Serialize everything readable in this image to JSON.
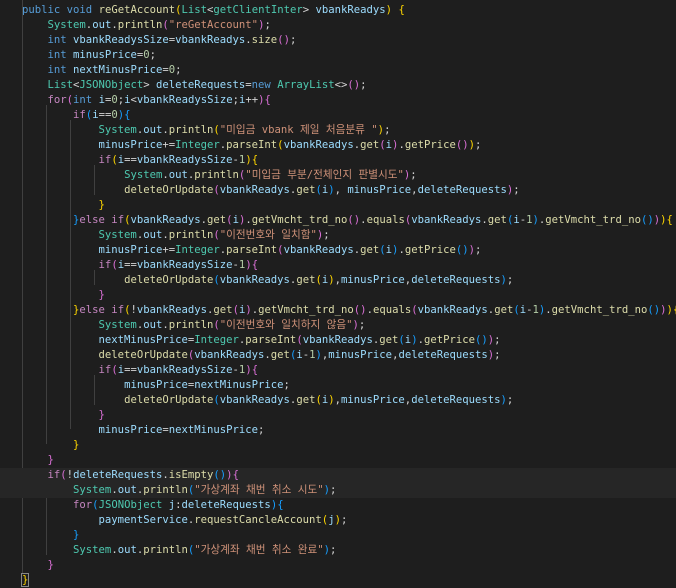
{
  "theme": {
    "background": "#1e1e1e",
    "line_highlight": "#262626",
    "keyword": "#569cd6",
    "control": "#c586c0",
    "type": "#4ec9b0",
    "function": "#dcdcaa",
    "variable": "#9cdcfe",
    "string": "#ce9178",
    "number": "#b5cea8",
    "text": "#d4d4d4",
    "bracket1": "#ffd700",
    "bracket2": "#da70d6",
    "bracket3": "#179fff"
  },
  "code_lines": [
    [
      [
        "k",
        "public"
      ],
      [
        "p",
        " "
      ],
      [
        "k",
        "void"
      ],
      [
        "p",
        " "
      ],
      [
        "f",
        "reGetAccount"
      ],
      [
        "b1",
        "("
      ],
      [
        "t",
        "List"
      ],
      [
        "p",
        "<"
      ],
      [
        "t",
        "getClientInter"
      ],
      [
        "p",
        "> "
      ],
      [
        "v",
        "vbankReadys"
      ],
      [
        "b1",
        ")"
      ],
      [
        "p",
        " "
      ],
      [
        "b1",
        "{"
      ]
    ],
    [
      [
        "p",
        "    "
      ],
      [
        "t",
        "System"
      ],
      [
        "p",
        "."
      ],
      [
        "v",
        "out"
      ],
      [
        "p",
        "."
      ],
      [
        "f",
        "println"
      ],
      [
        "b2",
        "("
      ],
      [
        "s",
        "\"reGetAccount\""
      ],
      [
        "b2",
        ")"
      ],
      [
        "p",
        ";"
      ]
    ],
    [
      [
        "p",
        "    "
      ],
      [
        "k",
        "int"
      ],
      [
        "p",
        " "
      ],
      [
        "v",
        "vbankReadysSize"
      ],
      [
        "p",
        "="
      ],
      [
        "v",
        "vbankReadys"
      ],
      [
        "p",
        "."
      ],
      [
        "f",
        "size"
      ],
      [
        "b2",
        "()"
      ],
      [
        "p",
        ";"
      ]
    ],
    [
      [
        "p",
        "    "
      ],
      [
        "k",
        "int"
      ],
      [
        "p",
        " "
      ],
      [
        "v",
        "minusPrice"
      ],
      [
        "p",
        "="
      ],
      [
        "n",
        "0"
      ],
      [
        "p",
        ";"
      ]
    ],
    [
      [
        "p",
        "    "
      ],
      [
        "k",
        "int"
      ],
      [
        "p",
        " "
      ],
      [
        "v",
        "nextMinusPrice"
      ],
      [
        "p",
        "="
      ],
      [
        "n",
        "0"
      ],
      [
        "p",
        ";"
      ]
    ],
    [
      [
        "p",
        "    "
      ],
      [
        "t",
        "List"
      ],
      [
        "p",
        "<"
      ],
      [
        "t",
        "JSONObject"
      ],
      [
        "p",
        "> "
      ],
      [
        "v",
        "deleteRequests"
      ],
      [
        "p",
        "="
      ],
      [
        "k",
        "new"
      ],
      [
        "p",
        " "
      ],
      [
        "t",
        "ArrayList"
      ],
      [
        "p",
        "<>"
      ],
      [
        "b2",
        "()"
      ],
      [
        "p",
        ";"
      ]
    ],
    [
      [
        "p",
        "    "
      ],
      [
        "c",
        "for"
      ],
      [
        "b2",
        "("
      ],
      [
        "k",
        "int"
      ],
      [
        "p",
        " "
      ],
      [
        "v",
        "i"
      ],
      [
        "p",
        "="
      ],
      [
        "n",
        "0"
      ],
      [
        "p",
        ";"
      ],
      [
        "v",
        "i"
      ],
      [
        "p",
        "<"
      ],
      [
        "v",
        "vbankReadysSize"
      ],
      [
        "p",
        ";"
      ],
      [
        "v",
        "i"
      ],
      [
        "p",
        "++"
      ],
      [
        "b2",
        ")"
      ],
      [
        "b2",
        "{"
      ]
    ],
    [
      [
        "p",
        "        "
      ],
      [
        "c",
        "if"
      ],
      [
        "b3",
        "("
      ],
      [
        "v",
        "i"
      ],
      [
        "p",
        "=="
      ],
      [
        "n",
        "0"
      ],
      [
        "b3",
        ")"
      ],
      [
        "b3",
        "{"
      ]
    ],
    [
      [
        "p",
        "            "
      ],
      [
        "t",
        "System"
      ],
      [
        "p",
        "."
      ],
      [
        "v",
        "out"
      ],
      [
        "p",
        "."
      ],
      [
        "f",
        "println"
      ],
      [
        "b1",
        "("
      ],
      [
        "s",
        "\"미입금 vbank 제일 처음분류 \""
      ],
      [
        "b1",
        ")"
      ],
      [
        "p",
        ";"
      ]
    ],
    [
      [
        "p",
        "            "
      ],
      [
        "v",
        "minusPrice"
      ],
      [
        "p",
        "+="
      ],
      [
        "t",
        "Integer"
      ],
      [
        "p",
        "."
      ],
      [
        "f",
        "parseInt"
      ],
      [
        "b1",
        "("
      ],
      [
        "v",
        "vbankReadys"
      ],
      [
        "p",
        "."
      ],
      [
        "f",
        "get"
      ],
      [
        "b2",
        "("
      ],
      [
        "v",
        "i"
      ],
      [
        "b2",
        ")"
      ],
      [
        "p",
        "."
      ],
      [
        "f",
        "getPrice"
      ],
      [
        "b2",
        "()"
      ],
      [
        "b1",
        ")"
      ],
      [
        "p",
        ";"
      ]
    ],
    [
      [
        "p",
        "            "
      ],
      [
        "c",
        "if"
      ],
      [
        "b1",
        "("
      ],
      [
        "v",
        "i"
      ],
      [
        "p",
        "=="
      ],
      [
        "v",
        "vbankReadysSize"
      ],
      [
        "p",
        "-"
      ],
      [
        "n",
        "1"
      ],
      [
        "b1",
        ")"
      ],
      [
        "b1",
        "{"
      ]
    ],
    [
      [
        "p",
        "                "
      ],
      [
        "t",
        "System"
      ],
      [
        "p",
        "."
      ],
      [
        "v",
        "out"
      ],
      [
        "p",
        "."
      ],
      [
        "f",
        "println"
      ],
      [
        "b2",
        "("
      ],
      [
        "s",
        "\"미입금 부분/전체인지 판별시도\""
      ],
      [
        "b2",
        ")"
      ],
      [
        "p",
        ";"
      ]
    ],
    [
      [
        "p",
        "                "
      ],
      [
        "f",
        "deleteOrUpdate"
      ],
      [
        "b2",
        "("
      ],
      [
        "v",
        "vbankReadys"
      ],
      [
        "p",
        "."
      ],
      [
        "f",
        "get"
      ],
      [
        "b3",
        "("
      ],
      [
        "v",
        "i"
      ],
      [
        "b3",
        ")"
      ],
      [
        "p",
        ", "
      ],
      [
        "v",
        "minusPrice"
      ],
      [
        "p",
        ","
      ],
      [
        "v",
        "deleteRequests"
      ],
      [
        "b2",
        ")"
      ],
      [
        "p",
        ";"
      ]
    ],
    [
      [
        "p",
        "            "
      ],
      [
        "b1",
        "}"
      ]
    ],
    [
      [
        "p",
        "        "
      ],
      [
        "b3",
        "}"
      ],
      [
        "c",
        "else if"
      ],
      [
        "b1",
        "("
      ],
      [
        "v",
        "vbankReadys"
      ],
      [
        "p",
        "."
      ],
      [
        "f",
        "get"
      ],
      [
        "b2",
        "("
      ],
      [
        "v",
        "i"
      ],
      [
        "b2",
        ")"
      ],
      [
        "p",
        "."
      ],
      [
        "f",
        "getVmcht_trd_no"
      ],
      [
        "b2",
        "()"
      ],
      [
        "p",
        "."
      ],
      [
        "f",
        "equals"
      ],
      [
        "b2",
        "("
      ],
      [
        "v",
        "vbankReadys"
      ],
      [
        "p",
        "."
      ],
      [
        "f",
        "get"
      ],
      [
        "b3",
        "("
      ],
      [
        "v",
        "i"
      ],
      [
        "p",
        "-"
      ],
      [
        "n",
        "1"
      ],
      [
        "b3",
        ")"
      ],
      [
        "p",
        "."
      ],
      [
        "f",
        "getVmcht_trd_no"
      ],
      [
        "b3",
        "()"
      ],
      [
        "b2",
        ")"
      ],
      [
        "b1",
        ")"
      ],
      [
        "b1",
        "{"
      ]
    ],
    [
      [
        "p",
        "            "
      ],
      [
        "t",
        "System"
      ],
      [
        "p",
        "."
      ],
      [
        "v",
        "out"
      ],
      [
        "p",
        "."
      ],
      [
        "f",
        "println"
      ],
      [
        "b2",
        "("
      ],
      [
        "s",
        "\"이전번호와 일치함\""
      ],
      [
        "b2",
        ")"
      ],
      [
        "p",
        ";"
      ]
    ],
    [
      [
        "p",
        "            "
      ],
      [
        "v",
        "minusPrice"
      ],
      [
        "p",
        "+="
      ],
      [
        "t",
        "Integer"
      ],
      [
        "p",
        "."
      ],
      [
        "f",
        "parseInt"
      ],
      [
        "b2",
        "("
      ],
      [
        "v",
        "vbankReadys"
      ],
      [
        "p",
        "."
      ],
      [
        "f",
        "get"
      ],
      [
        "b3",
        "("
      ],
      [
        "v",
        "i"
      ],
      [
        "b3",
        ")"
      ],
      [
        "p",
        "."
      ],
      [
        "f",
        "getPrice"
      ],
      [
        "b3",
        "()"
      ],
      [
        "b2",
        ")"
      ],
      [
        "p",
        ";"
      ]
    ],
    [
      [
        "p",
        "            "
      ],
      [
        "c",
        "if"
      ],
      [
        "b2",
        "("
      ],
      [
        "v",
        "i"
      ],
      [
        "p",
        "=="
      ],
      [
        "v",
        "vbankReadysSize"
      ],
      [
        "p",
        "-"
      ],
      [
        "n",
        "1"
      ],
      [
        "b2",
        ")"
      ],
      [
        "b2",
        "{"
      ]
    ],
    [
      [
        "p",
        "                "
      ],
      [
        "f",
        "deleteOrUpdate"
      ],
      [
        "b3",
        "("
      ],
      [
        "v",
        "vbankReadys"
      ],
      [
        "p",
        "."
      ],
      [
        "f",
        "get"
      ],
      [
        "b1",
        "("
      ],
      [
        "v",
        "i"
      ],
      [
        "b1",
        ")"
      ],
      [
        "p",
        ","
      ],
      [
        "v",
        "minusPrice"
      ],
      [
        "p",
        ","
      ],
      [
        "v",
        "deleteRequests"
      ],
      [
        "b3",
        ")"
      ],
      [
        "p",
        ";"
      ]
    ],
    [
      [
        "p",
        "            "
      ],
      [
        "b2",
        "}"
      ]
    ],
    [
      [
        "p",
        "        "
      ],
      [
        "b1",
        "}"
      ],
      [
        "c",
        "else if"
      ],
      [
        "b1",
        "("
      ],
      [
        "p",
        "!"
      ],
      [
        "v",
        "vbankReadys"
      ],
      [
        "p",
        "."
      ],
      [
        "f",
        "get"
      ],
      [
        "b2",
        "("
      ],
      [
        "v",
        "i"
      ],
      [
        "b2",
        ")"
      ],
      [
        "p",
        "."
      ],
      [
        "f",
        "getVmcht_trd_no"
      ],
      [
        "b2",
        "()"
      ],
      [
        "p",
        "."
      ],
      [
        "f",
        "equals"
      ],
      [
        "b2",
        "("
      ],
      [
        "v",
        "vbankReadys"
      ],
      [
        "p",
        "."
      ],
      [
        "f",
        "get"
      ],
      [
        "b3",
        "("
      ],
      [
        "v",
        "i"
      ],
      [
        "p",
        "-"
      ],
      [
        "n",
        "1"
      ],
      [
        "b3",
        ")"
      ],
      [
        "p",
        "."
      ],
      [
        "f",
        "getVmcht_trd_no"
      ],
      [
        "b3",
        "()"
      ],
      [
        "b2",
        ")"
      ],
      [
        "b1",
        ")"
      ],
      [
        "b1",
        "{"
      ]
    ],
    [
      [
        "p",
        "            "
      ],
      [
        "t",
        "System"
      ],
      [
        "p",
        "."
      ],
      [
        "v",
        "out"
      ],
      [
        "p",
        "."
      ],
      [
        "f",
        "println"
      ],
      [
        "b2",
        "("
      ],
      [
        "s",
        "\"이전번호와 일치하지 않음\""
      ],
      [
        "b2",
        ")"
      ],
      [
        "p",
        ";"
      ]
    ],
    [
      [
        "p",
        "            "
      ],
      [
        "v",
        "nextMinusPrice"
      ],
      [
        "p",
        "="
      ],
      [
        "t",
        "Integer"
      ],
      [
        "p",
        "."
      ],
      [
        "f",
        "parseInt"
      ],
      [
        "b2",
        "("
      ],
      [
        "v",
        "vbankReadys"
      ],
      [
        "p",
        "."
      ],
      [
        "f",
        "get"
      ],
      [
        "b3",
        "("
      ],
      [
        "v",
        "i"
      ],
      [
        "b3",
        ")"
      ],
      [
        "p",
        "."
      ],
      [
        "f",
        "getPrice"
      ],
      [
        "b3",
        "()"
      ],
      [
        "b2",
        ")"
      ],
      [
        "p",
        ";"
      ]
    ],
    [
      [
        "p",
        "            "
      ],
      [
        "f",
        "deleteOrUpdate"
      ],
      [
        "b2",
        "("
      ],
      [
        "v",
        "vbankReadys"
      ],
      [
        "p",
        "."
      ],
      [
        "f",
        "get"
      ],
      [
        "b3",
        "("
      ],
      [
        "v",
        "i"
      ],
      [
        "p",
        "-"
      ],
      [
        "n",
        "1"
      ],
      [
        "b3",
        ")"
      ],
      [
        "p",
        ","
      ],
      [
        "v",
        "minusPrice"
      ],
      [
        "p",
        ","
      ],
      [
        "v",
        "deleteRequests"
      ],
      [
        "b2",
        ")"
      ],
      [
        "p",
        ";"
      ]
    ],
    [
      [
        "p",
        "            "
      ],
      [
        "c",
        "if"
      ],
      [
        "b2",
        "("
      ],
      [
        "v",
        "i"
      ],
      [
        "p",
        "=="
      ],
      [
        "v",
        "vbankReadysSize"
      ],
      [
        "p",
        "-"
      ],
      [
        "n",
        "1"
      ],
      [
        "b2",
        ")"
      ],
      [
        "b2",
        "{"
      ]
    ],
    [
      [
        "p",
        "                "
      ],
      [
        "v",
        "minusPrice"
      ],
      [
        "p",
        "="
      ],
      [
        "v",
        "nextMinusPrice"
      ],
      [
        "p",
        ";"
      ]
    ],
    [
      [
        "p",
        "                "
      ],
      [
        "f",
        "deleteOrUpdate"
      ],
      [
        "b3",
        "("
      ],
      [
        "v",
        "vbankReadys"
      ],
      [
        "p",
        "."
      ],
      [
        "f",
        "get"
      ],
      [
        "b1",
        "("
      ],
      [
        "v",
        "i"
      ],
      [
        "b1",
        ")"
      ],
      [
        "p",
        ","
      ],
      [
        "v",
        "minusPrice"
      ],
      [
        "p",
        ","
      ],
      [
        "v",
        "deleteRequests"
      ],
      [
        "b3",
        ")"
      ],
      [
        "p",
        ";"
      ]
    ],
    [
      [
        "p",
        "            "
      ],
      [
        "b2",
        "}"
      ]
    ],
    [
      [
        "p",
        "            "
      ],
      [
        "v",
        "minusPrice"
      ],
      [
        "p",
        "="
      ],
      [
        "v",
        "nextMinusPrice"
      ],
      [
        "p",
        ";"
      ]
    ],
    [
      [
        "p",
        "        "
      ],
      [
        "b1",
        "}"
      ]
    ],
    [
      [
        "p",
        "    "
      ],
      [
        "b2",
        "}"
      ]
    ],
    [
      [
        "p",
        "    "
      ],
      [
        "c",
        "if"
      ],
      [
        "b2",
        "("
      ],
      [
        "p",
        "!"
      ],
      [
        "v",
        "deleteRequests"
      ],
      [
        "p",
        "."
      ],
      [
        "f",
        "isEmpty"
      ],
      [
        "b3",
        "()"
      ],
      [
        "b2",
        ")"
      ],
      [
        "b2",
        "{"
      ]
    ],
    [
      [
        "p",
        "        "
      ],
      [
        "t",
        "System"
      ],
      [
        "p",
        "."
      ],
      [
        "v",
        "out"
      ],
      [
        "p",
        "."
      ],
      [
        "f",
        "println"
      ],
      [
        "b3",
        "("
      ],
      [
        "s",
        "\"가상계좌 채번 취소 시도\""
      ],
      [
        "b3",
        ")"
      ],
      [
        "p",
        ";"
      ]
    ],
    [
      [
        "p",
        "        "
      ],
      [
        "c",
        "for"
      ],
      [
        "b3",
        "("
      ],
      [
        "t",
        "JSONObject"
      ],
      [
        "p",
        " "
      ],
      [
        "v",
        "j"
      ],
      [
        "p",
        ":"
      ],
      [
        "v",
        "deleteRequests"
      ],
      [
        "b3",
        ")"
      ],
      [
        "b3",
        "{"
      ]
    ],
    [
      [
        "p",
        "            "
      ],
      [
        "v",
        "paymentService"
      ],
      [
        "p",
        "."
      ],
      [
        "f",
        "requestCancleAccount"
      ],
      [
        "b1",
        "("
      ],
      [
        "v",
        "j"
      ],
      [
        "b1",
        ")"
      ],
      [
        "p",
        ";"
      ]
    ],
    [
      [
        "p",
        "        "
      ],
      [
        "b3",
        "}"
      ]
    ],
    [
      [
        "p",
        "        "
      ],
      [
        "t",
        "System"
      ],
      [
        "p",
        "."
      ],
      [
        "v",
        "out"
      ],
      [
        "p",
        "."
      ],
      [
        "f",
        "println"
      ],
      [
        "b3",
        "("
      ],
      [
        "s",
        "\"가상계좌 채번 취소 완료\""
      ],
      [
        "b3",
        ")"
      ],
      [
        "p",
        ";"
      ]
    ],
    [
      [
        "p",
        "    "
      ],
      [
        "b2",
        "}"
      ]
    ],
    [
      [
        "b1",
        "}"
      ]
    ]
  ]
}
